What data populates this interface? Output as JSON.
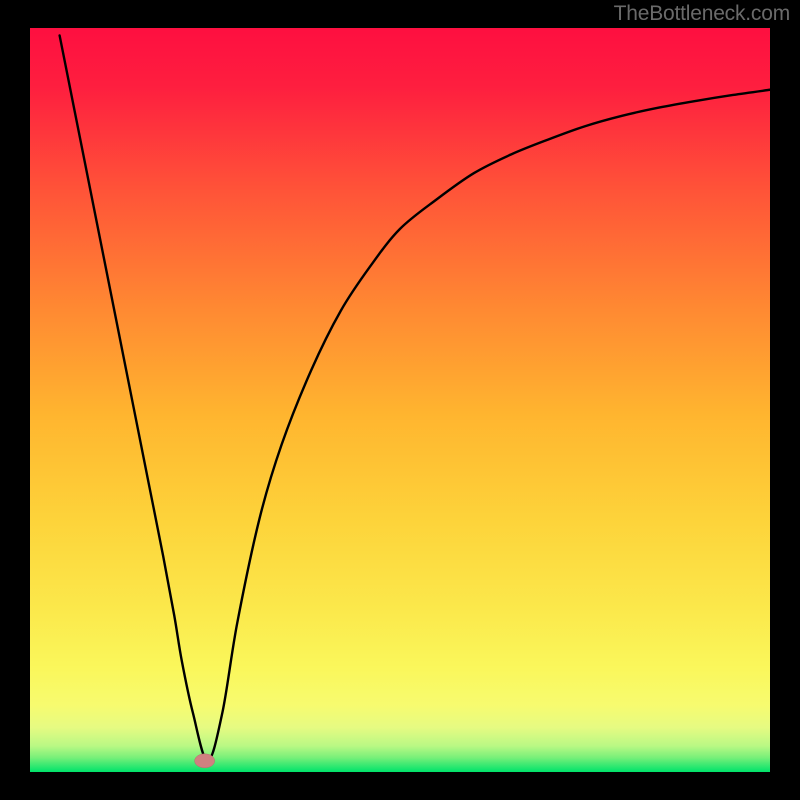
{
  "watermark": "TheBottleneck.com",
  "chart_data": {
    "type": "line",
    "title": "",
    "xlabel": "",
    "ylabel": "",
    "xlim": [
      0,
      100
    ],
    "ylim": [
      0,
      100
    ],
    "x": [
      4,
      6,
      8,
      10,
      12,
      14,
      16,
      18,
      19.5,
      20.5,
      22,
      24,
      26,
      28,
      31,
      34,
      38,
      42,
      46,
      50,
      55,
      60,
      65,
      70,
      75,
      80,
      85,
      90,
      95,
      100
    ],
    "y": [
      99,
      89,
      79,
      69,
      59,
      49,
      39,
      29,
      21,
      15,
      8,
      1.5,
      8,
      20,
      34,
      44,
      54,
      62,
      68,
      73,
      77,
      80.5,
      83,
      85,
      86.8,
      88.2,
      89.3,
      90.2,
      91,
      91.7
    ],
    "annotations": [
      {
        "kind": "marker",
        "shape": "ellipse",
        "x": 23.6,
        "y": 1.5,
        "color": "#d08080"
      }
    ],
    "background_gradient": {
      "top_color": "#fe0f40",
      "mid_color": "#ffb52f",
      "low_color": "#faf75b",
      "bottom_band_color": "#00e36b"
    },
    "frame_color": "#000000",
    "curve_color": "#000000"
  }
}
